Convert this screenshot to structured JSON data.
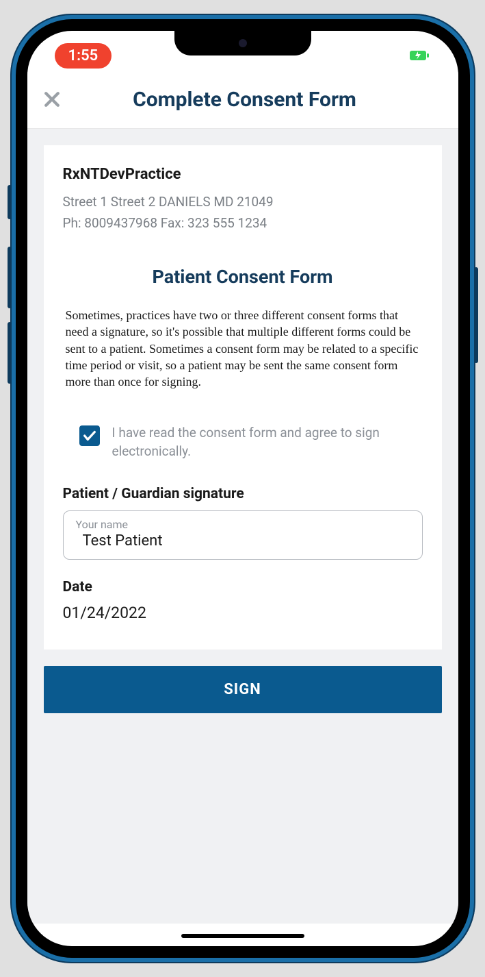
{
  "status": {
    "time": "1:55"
  },
  "header": {
    "title": "Complete Consent Form"
  },
  "practice": {
    "name": "RxNTDevPractice",
    "address": "Street 1 Street 2 DANIELS MD 21049",
    "contact": "Ph: 8009437968     Fax: 323 555 1234"
  },
  "form": {
    "title": "Patient Consent Form",
    "body": "Sometimes, practices have two or three different consent forms that need a signature, so it's possible that multiple different forms could be sent to a patient. Sometimes a consent form may be related to a specific time period or visit, so a patient may be sent the same consent form more than once for signing.",
    "consent_text": "I have read the consent form and agree to sign electronically.",
    "consent_checked": true,
    "signature_label": "Patient / Guardian signature",
    "signature_placeholder": "Your name",
    "signature_value": "Test Patient",
    "date_label": "Date",
    "date_value": "01/24/2022",
    "sign_button": "SIGN"
  }
}
